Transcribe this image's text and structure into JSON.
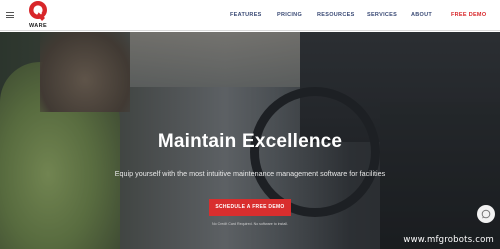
{
  "brand": {
    "logo_text": "WARE",
    "accent_color": "#d8262a"
  },
  "nav": {
    "items": [
      {
        "label": "FEATURES"
      },
      {
        "label": "PRICING"
      },
      {
        "label": "RESOURCES"
      },
      {
        "label": "SERVICES"
      },
      {
        "label": "ABOUT"
      }
    ],
    "cta_label": "FREE DEMO"
  },
  "hero": {
    "title": "Maintain Excellence",
    "subtitle": "Equip yourself with the most intuitive maintenance management software for facilities",
    "button_label": "SCHEDULE A FREE DEMO",
    "fine_print": "No Credit Card Required. No software to install.",
    "chat_icon": "chat-bubble-icon"
  },
  "watermark": "www.mfgrobots.com"
}
